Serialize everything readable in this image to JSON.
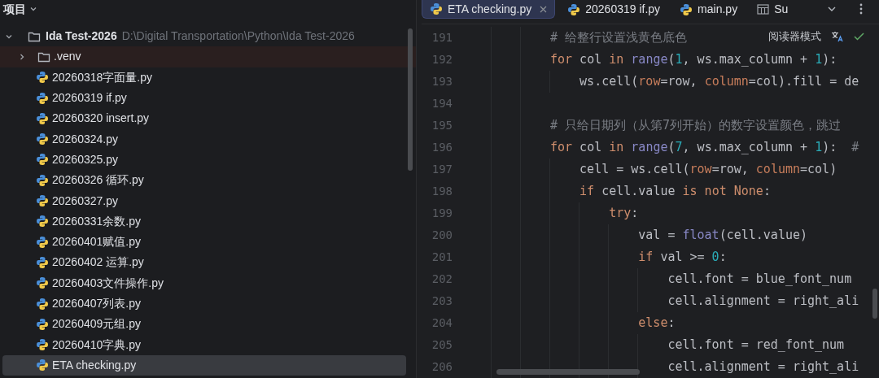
{
  "project_panel": {
    "title": "项目",
    "root": {
      "name": "Ida Test-2026",
      "path": "D:\\Digital Transportation\\Python\\Ida Test-2026",
      "expanded": true,
      "children": [
        {
          "kind": "folder",
          "name": ".venv",
          "expanded": false,
          "excluded": true,
          "selected": false
        },
        {
          "kind": "file",
          "name": "20260318字面量.py",
          "selected": false
        },
        {
          "kind": "file",
          "name": "20260319 if.py",
          "selected": false
        },
        {
          "kind": "file",
          "name": "20260320 insert.py",
          "selected": false
        },
        {
          "kind": "file",
          "name": "20260324.py",
          "selected": false
        },
        {
          "kind": "file",
          "name": "20260325.py",
          "selected": false
        },
        {
          "kind": "file",
          "name": "20260326 循环.py",
          "selected": false
        },
        {
          "kind": "file",
          "name": "20260327.py",
          "selected": false
        },
        {
          "kind": "file",
          "name": "20260331余数.py",
          "selected": false
        },
        {
          "kind": "file",
          "name": "20260401赋值.py",
          "selected": false
        },
        {
          "kind": "file",
          "name": "20260402 运算.py",
          "selected": false
        },
        {
          "kind": "file",
          "name": "20260403文件操作.py",
          "selected": false
        },
        {
          "kind": "file",
          "name": "20260407列表.py",
          "selected": false
        },
        {
          "kind": "file",
          "name": "20260409元组.py",
          "selected": false
        },
        {
          "kind": "file",
          "name": "20260410字典.py",
          "selected": false
        },
        {
          "kind": "file",
          "name": "ETA checking.py",
          "selected": true
        }
      ]
    }
  },
  "editor": {
    "tabs": [
      {
        "kind": "python",
        "label": "ETA checking.py",
        "selected": true
      },
      {
        "kind": "python",
        "label": "20260319 if.py",
        "selected": false
      },
      {
        "kind": "python",
        "label": "main.py",
        "selected": false
      },
      {
        "kind": "table",
        "label": "Su",
        "selected": false
      }
    ],
    "reader_mode": "阅读器模式",
    "lines": [
      {
        "number": "191",
        "tokens": [
          {
            "kind": "comment",
            "text": "# 给整行设置浅黄色底色"
          }
        ]
      },
      {
        "number": "192",
        "tokens": [
          {
            "kind": "keyword",
            "text": "for"
          },
          {
            "kind": "plain",
            "text": " col "
          },
          {
            "kind": "keyword",
            "text": "in"
          },
          {
            "kind": "builtin",
            "text": " range"
          },
          {
            "kind": "plain",
            "text": "("
          },
          {
            "kind": "number",
            "text": "1"
          },
          {
            "kind": "plain",
            "text": ", ws.max_column + "
          },
          {
            "kind": "number",
            "text": "1"
          },
          {
            "kind": "plain",
            "text": "):"
          }
        ],
        "children": [
          {
            "number": "193",
            "tokens": [
              {
                "kind": "plain",
                "text": "ws.cell("
              },
              {
                "kind": "param",
                "text": "row"
              },
              {
                "kind": "plain",
                "text": "=row, "
              },
              {
                "kind": "param",
                "text": "column"
              },
              {
                "kind": "plain",
                "text": "=col).fill = de"
              }
            ]
          }
        ]
      },
      {
        "number": "194"
      },
      {
        "number": "195",
        "tokens": [
          {
            "kind": "comment",
            "text": "# 只给日期列（从第7列开始）的数字设置颜色，跳过"
          }
        ]
      },
      {
        "number": "196",
        "tokens": [
          {
            "kind": "keyword",
            "text": "for"
          },
          {
            "kind": "plain",
            "text": " col "
          },
          {
            "kind": "keyword",
            "text": "in"
          },
          {
            "kind": "builtin",
            "text": " range"
          },
          {
            "kind": "plain",
            "text": "("
          },
          {
            "kind": "number",
            "text": "7"
          },
          {
            "kind": "plain",
            "text": ", ws.max_column + "
          },
          {
            "kind": "number",
            "text": "1"
          },
          {
            "kind": "plain",
            "text": "):"
          },
          {
            "kind": "comment",
            "text": "  #"
          }
        ],
        "children": [
          {
            "number": "197",
            "tokens": [
              {
                "kind": "plain",
                "text": "cell = ws.cell("
              },
              {
                "kind": "param",
                "text": "row"
              },
              {
                "kind": "plain",
                "text": "=row, "
              },
              {
                "kind": "param",
                "text": "column"
              },
              {
                "kind": "plain",
                "text": "=col)"
              }
            ]
          },
          {
            "number": "198",
            "tokens": [
              {
                "kind": "keyword",
                "text": "if"
              },
              {
                "kind": "plain",
                "text": " cell.value "
              },
              {
                "kind": "keyword",
                "text": "is not None"
              },
              {
                "kind": "plain",
                "text": ":"
              }
            ],
            "children": [
              {
                "number": "199",
                "tokens": [
                  {
                    "kind": "keyword",
                    "text": "try"
                  },
                  {
                    "kind": "plain",
                    "text": ":"
                  }
                ],
                "children": [
                  {
                    "number": "200",
                    "tokens": [
                      {
                        "kind": "plain",
                        "text": "val = "
                      },
                      {
                        "kind": "builtin",
                        "text": "float"
                      },
                      {
                        "kind": "plain",
                        "text": "(cell.value)"
                      }
                    ]
                  },
                  {
                    "number": "201",
                    "tokens": [
                      {
                        "kind": "keyword",
                        "text": "if"
                      },
                      {
                        "kind": "plain",
                        "text": " val >= "
                      },
                      {
                        "kind": "number",
                        "text": "0"
                      },
                      {
                        "kind": "plain",
                        "text": ":"
                      }
                    ],
                    "children": [
                      {
                        "number": "202",
                        "tokens": [
                          {
                            "kind": "plain",
                            "text": "cell.font = blue_font_num"
                          }
                        ]
                      },
                      {
                        "number": "203",
                        "tokens": [
                          {
                            "kind": "plain",
                            "text": "cell.alignment = right_ali"
                          }
                        ]
                      }
                    ]
                  },
                  {
                    "number": "204",
                    "tokens": [
                      {
                        "kind": "keyword",
                        "text": "else"
                      },
                      {
                        "kind": "plain",
                        "text": ":"
                      }
                    ],
                    "children": [
                      {
                        "number": "205",
                        "tokens": [
                          {
                            "kind": "plain",
                            "text": "cell.font = red_font_num"
                          }
                        ]
                      },
                      {
                        "number": "206",
                        "tokens": [
                          {
                            "kind": "plain",
                            "text": "cell.alignment = right_ali"
                          }
                        ]
                      }
                    ]
                  }
                ]
              }
            ]
          }
        ]
      }
    ]
  }
}
